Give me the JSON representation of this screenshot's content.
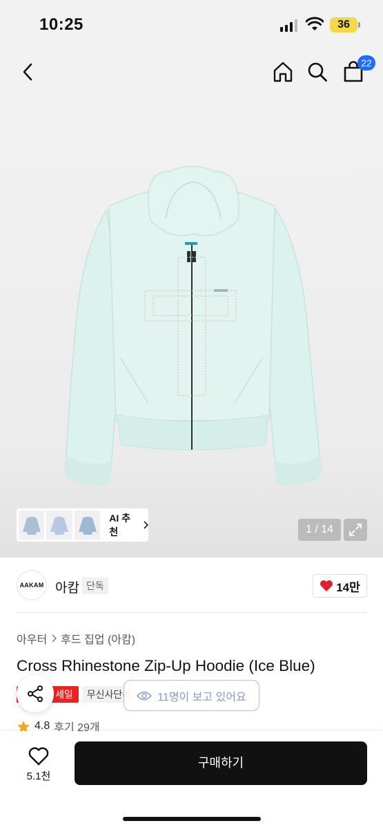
{
  "status_bar": {
    "time": "10:25",
    "battery": "36"
  },
  "nav": {
    "cart_count": "22"
  },
  "gallery": {
    "ai_recommend_label": "AI 추천",
    "page_counter": "1 / 14",
    "thumb_colors": [
      "#a9c0d6",
      "#b8c8e2",
      "#9fb8d2"
    ],
    "hoodie_color": "#dff3ef",
    "rhinestone_color": "#e8c9c0"
  },
  "brand": {
    "logo_text": "AAKAM",
    "name": "아캄",
    "tag": "단독",
    "like_count": "14만"
  },
  "breadcrumb": {
    "level1": "아우터",
    "level2": "후드 집업 (아캄)"
  },
  "product": {
    "title": "Cross Rhinestone Zip-Up Hoodie (Ice Blue)"
  },
  "badges": {
    "sale": "세일",
    "exclusive": "무신사단독"
  },
  "viewers": {
    "text": "11명이 보고 있어요"
  },
  "rating": {
    "score": "4.8",
    "reviews": "후기 29개"
  },
  "bottom_bar": {
    "wish_count": "5.1천",
    "buy_label": "구매하기"
  },
  "colors": {
    "accent_blue": "#1e6bff",
    "sale_red": "#ee2222",
    "heart_red": "#e0202e",
    "buy_black": "#111111"
  }
}
